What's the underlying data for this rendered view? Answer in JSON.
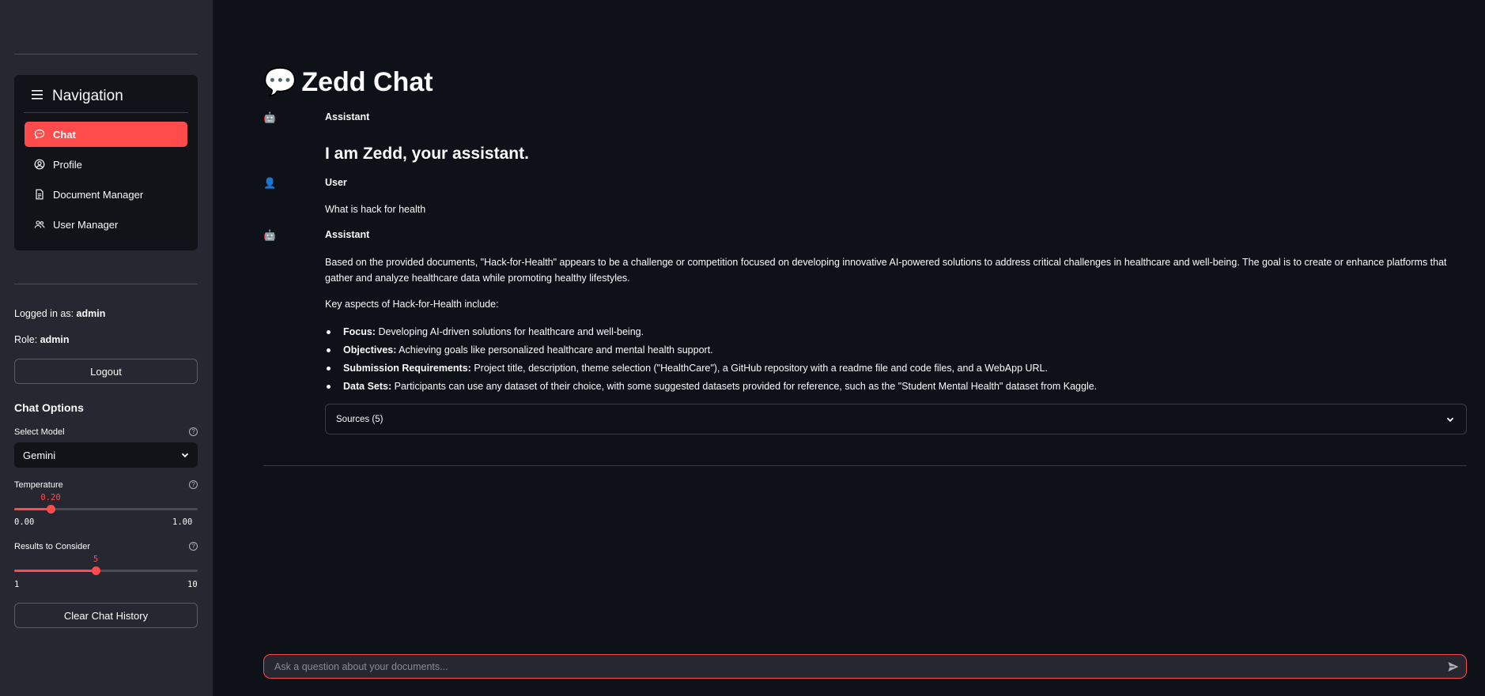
{
  "sidebar": {
    "nav_title": "Navigation",
    "nav_items": [
      {
        "label": "Chat",
        "icon": "chat-bubble-icon",
        "active": true
      },
      {
        "label": "Profile",
        "icon": "user-circle-icon",
        "active": false
      },
      {
        "label": "Document Manager",
        "icon": "document-icon",
        "active": false
      },
      {
        "label": "User Manager",
        "icon": "users-icon",
        "active": false
      }
    ],
    "logged_in_label": "Logged in as:",
    "logged_in_user": "admin",
    "role_label": "Role:",
    "role_value": "admin",
    "logout_label": "Logout",
    "options_title": "Chat Options",
    "model": {
      "label": "Select Model",
      "value": "Gemini",
      "help_icon": "?"
    },
    "temperature": {
      "label": "Temperature",
      "value": "0.20",
      "min": "0.00",
      "max": "1.00",
      "fraction": 0.2,
      "help_icon": "?"
    },
    "results": {
      "label": "Results to Consider",
      "value": "5",
      "min": "1",
      "max": "10",
      "fraction": 0.444,
      "help_icon": "?"
    },
    "clear_label": "Clear Chat History"
  },
  "main": {
    "title_emoji": "💬",
    "title": "Zedd Chat",
    "messages": [
      {
        "role": "Assistant",
        "avatar": "🤖",
        "heading": "I am Zedd, your assistant."
      },
      {
        "role": "User",
        "avatar": "👤",
        "text": "What is hack for health"
      },
      {
        "role": "Assistant",
        "avatar": "🤖",
        "para1": "Based on the provided documents, \"Hack-for-Health\" appears to be a challenge or competition focused on developing innovative AI-powered solutions to address critical challenges in healthcare and well-being. The goal is to create or enhance platforms that gather and analyze healthcare data while promoting healthy lifestyles.",
        "para2": "Key aspects of Hack-for-Health include:",
        "bullets": [
          {
            "term": "Focus:",
            "text": " Developing AI-driven solutions for healthcare and well-being."
          },
          {
            "term": "Objectives:",
            "text": " Achieving goals like personalized healthcare and mental health support."
          },
          {
            "term": "Submission Requirements:",
            "text": " Project title, description, theme selection (\"HealthCare\"), a GitHub repository with a readme file and code files, and a WebApp URL."
          },
          {
            "term": "Data Sets:",
            "text": " Participants can use any dataset of their choice, with some suggested datasets provided for reference, such as the \"Student Mental Health\" dataset from Kaggle."
          }
        ],
        "sources_label": "Sources (5)"
      }
    ],
    "input_placeholder": "Ask a question about your documents..."
  },
  "colors": {
    "accent": "#ff4b4b",
    "background": "#0e1117",
    "sidebar": "#262730"
  }
}
